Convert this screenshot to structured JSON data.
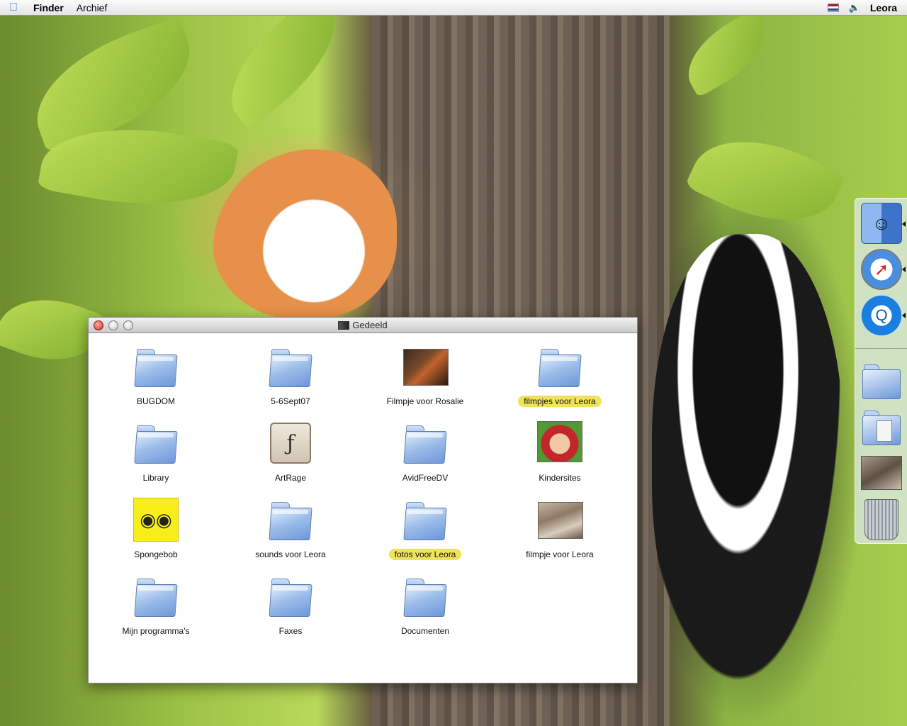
{
  "menubar": {
    "app_name": "Finder",
    "menus": [
      "Archief"
    ],
    "user": "Leora",
    "flag_colors": [
      "#ae1c28",
      "#ffffff",
      "#21468b"
    ]
  },
  "window": {
    "title": "Gedeeld",
    "items": [
      {
        "label": "BUGDOM",
        "icon": "folder-icon",
        "highlight": false
      },
      {
        "label": "5-6Sept07",
        "icon": "folder-icon",
        "highlight": false
      },
      {
        "label": "Filmpje voor Rosalie",
        "icon": "movie-thumbnail-icon",
        "highlight": false
      },
      {
        "label": "filmpjes voor Leora",
        "icon": "folder-icon",
        "highlight": true
      },
      {
        "label": "Library",
        "icon": "folder-icon",
        "highlight": false
      },
      {
        "label": "ArtRage",
        "icon": "artrage-app-icon",
        "highlight": false
      },
      {
        "label": "AvidFreeDV",
        "icon": "folder-icon",
        "highlight": false
      },
      {
        "label": "Kindersites",
        "icon": "teletubby-thumbnail-icon",
        "highlight": false
      },
      {
        "label": "Spongebob",
        "icon": "spongebob-icon",
        "highlight": false
      },
      {
        "label": "sounds voor Leora",
        "icon": "folder-icon",
        "highlight": false
      },
      {
        "label": "fotos voor Leora",
        "icon": "folder-icon",
        "highlight": true
      },
      {
        "label": "filmpje voor Leora",
        "icon": "movie-thumbnail-icon",
        "highlight": false
      },
      {
        "label": "Mijn programma's",
        "icon": "folder-icon",
        "highlight": false
      },
      {
        "label": "Faxes",
        "icon": "folder-icon",
        "highlight": false
      },
      {
        "label": "Documenten",
        "icon": "folder-icon",
        "highlight": false
      }
    ]
  },
  "dock": {
    "items": [
      "finder-icon",
      "safari-icon",
      "quicktime-icon",
      "folder-icon",
      "documents-folder-icon",
      "photo-icon",
      "trash-icon"
    ]
  },
  "colors": {
    "highlight": "#f0e35c",
    "close_button": "#d12a1c"
  }
}
